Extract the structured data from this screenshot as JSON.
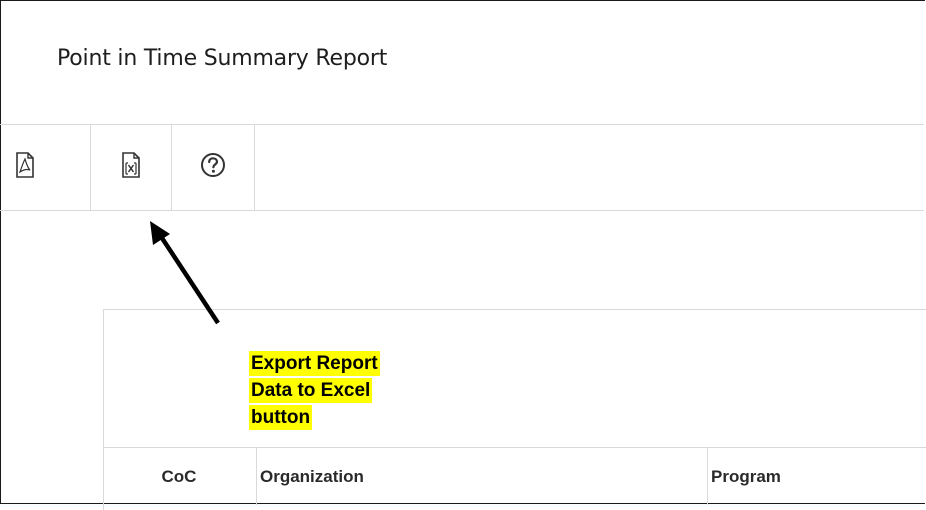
{
  "window": {
    "title": "Point in Time Summary Report"
  },
  "toolbar": {
    "buttons": [
      {
        "icon": "pdf-file-icon"
      },
      {
        "icon": "excel-file-icon"
      },
      {
        "icon": "help-circle-icon"
      }
    ]
  },
  "table": {
    "columns": [
      "CoC",
      "Organization",
      "Program"
    ]
  },
  "annotation": {
    "lines": [
      "Export Report",
      "Data to Excel",
      "button"
    ],
    "highlight_color": "#ffff00"
  }
}
